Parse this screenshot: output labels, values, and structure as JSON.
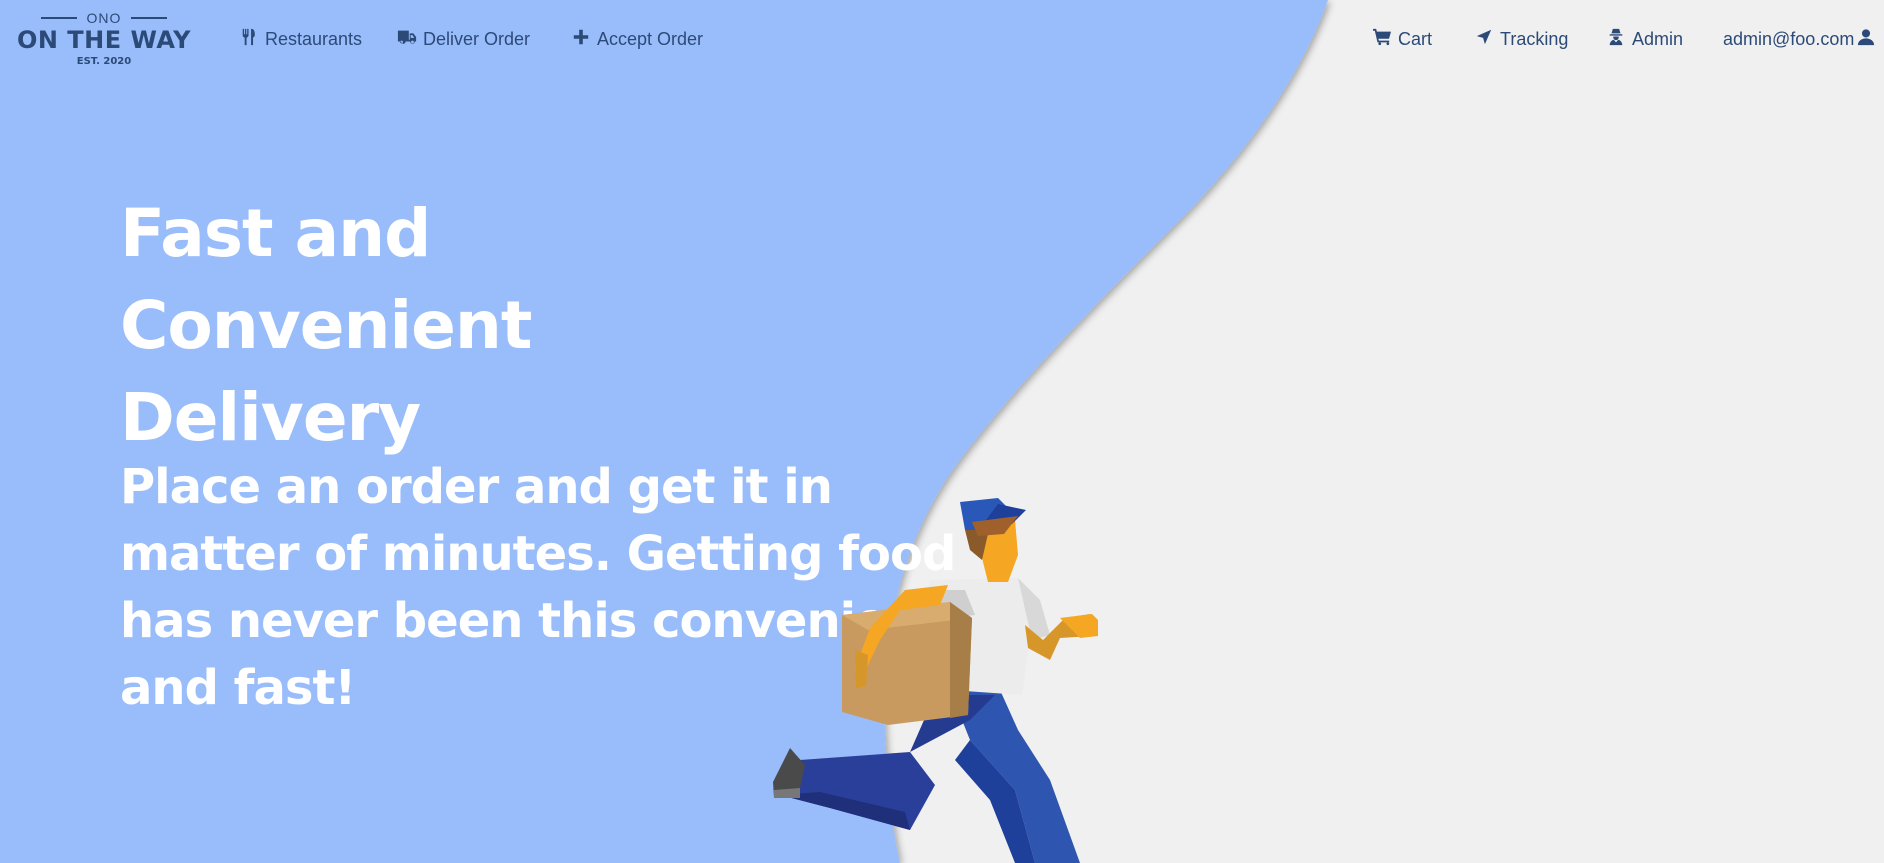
{
  "colors": {
    "hero_blue": "#99bdfb",
    "background_gray": "#f0f0f0",
    "nav_text": "#2c4a78",
    "hero_text": "#ffffff"
  },
  "logo": {
    "top": "ONO",
    "main": "ON THE WAY",
    "est": "EST. 2020"
  },
  "nav": {
    "left": [
      {
        "label": "Restaurants",
        "icon": "utensils-icon"
      },
      {
        "label": "Deliver Order",
        "icon": "truck-icon"
      },
      {
        "label": "Accept Order",
        "icon": "plus-icon"
      }
    ],
    "right": [
      {
        "label": "Cart",
        "icon": "cart-icon"
      },
      {
        "label": "Tracking",
        "icon": "location-arrow-icon"
      },
      {
        "label": "Admin",
        "icon": "user-secret-icon"
      },
      {
        "label": "admin@foo.com",
        "icon": "user-icon"
      }
    ]
  },
  "hero": {
    "title": "Fast and Convenient Delivery",
    "subtitle": "Place an order and get it in matter of minutes. Getting food has never been this convenient and fast!"
  },
  "illustration": {
    "icon": "running-delivery-man-illustration"
  }
}
